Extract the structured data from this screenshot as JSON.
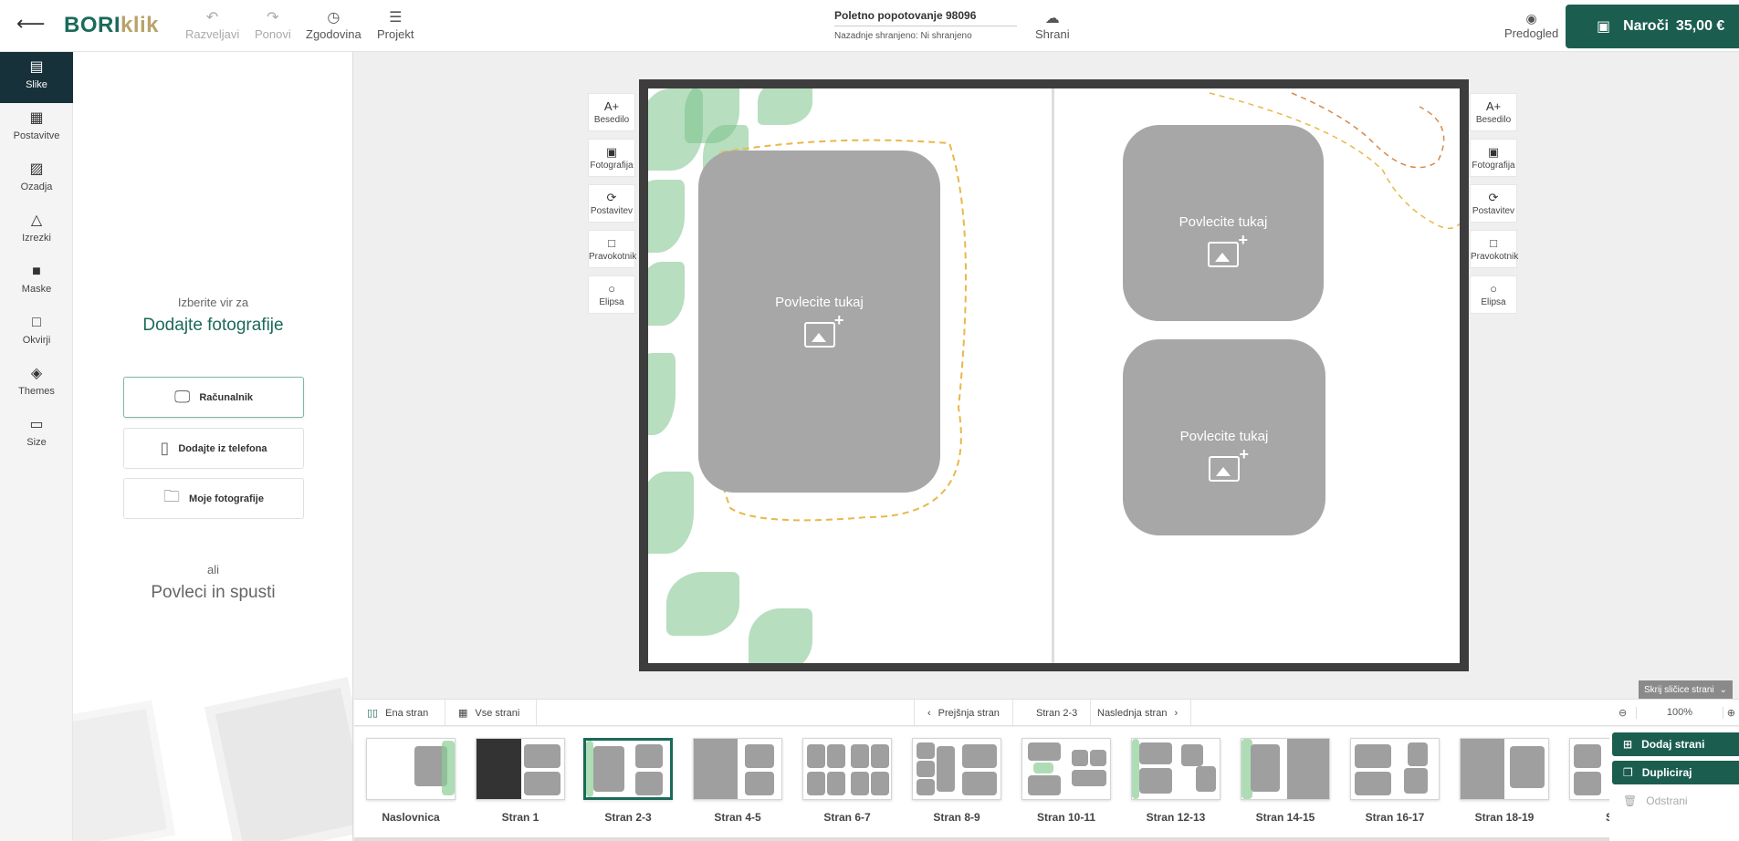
{
  "header": {
    "logo_part1": "BORI",
    "logo_part2": "klik",
    "undo": "Razveljavi",
    "redo": "Ponovi",
    "history": "Zgodovina",
    "project": "Projekt",
    "project_title": "Poletno popotovanje 98096",
    "last_saved": "Nazadnje shranjeno: Ni shranjeno",
    "save": "Shrani",
    "preview": "Predogled",
    "order": "Naroči",
    "price": "35,00 €"
  },
  "iconbar": {
    "items": [
      {
        "label": "Slike",
        "icon": "images-icon"
      },
      {
        "label": "Postavitve",
        "icon": "layout-icon"
      },
      {
        "label": "Ozadja",
        "icon": "background-icon"
      },
      {
        "label": "Izrezki",
        "icon": "clipart-icon"
      },
      {
        "label": "Maske",
        "icon": "mask-icon"
      },
      {
        "label": "Okvirji",
        "icon": "frame-icon"
      },
      {
        "label": "Themes",
        "icon": "themes-icon"
      },
      {
        "label": "Size",
        "icon": "ruler-icon"
      }
    ]
  },
  "panel": {
    "pick_source": "Izberite vir za",
    "add_photos": "Dodajte fotografije",
    "computer": "Računalnik",
    "from_phone": "Dodajte iz telefona",
    "my_photos": "Moje fotografije",
    "or": "ali",
    "drag_drop": "Povleci in spusti"
  },
  "tools": {
    "text": "Besedilo",
    "photo": "Fotografija",
    "layout": "Postavitev",
    "rect": "Pravokotnik",
    "ellipse": "Elipsa"
  },
  "canvas": {
    "drop_here": "Povlecite tukaj"
  },
  "nav": {
    "one_page": "Ena stran",
    "all_pages": "Vse strani",
    "prev": "Prejšnja stran",
    "current": "Stran 2-3",
    "next": "Naslednja stran",
    "hide_thumbs": "Skrij sličice strani",
    "zoom": "100%"
  },
  "thumbnails": [
    "Naslovnica",
    "Stran 1",
    "Stran 2-3",
    "Stran 4-5",
    "Stran 6-7",
    "Stran 8-9",
    "Stran 10-11",
    "Stran 12-13",
    "Stran 14-15",
    "Stran 16-17",
    "Stran 18-19",
    "Stra"
  ],
  "actions": {
    "add_page": "Dodaj strani",
    "duplicate": "Dupliciraj",
    "remove": "Odstrani"
  },
  "colors": {
    "brand": "#1b5e50",
    "accent": "#1b6a5a",
    "placeholder": "#a7a7a7"
  }
}
